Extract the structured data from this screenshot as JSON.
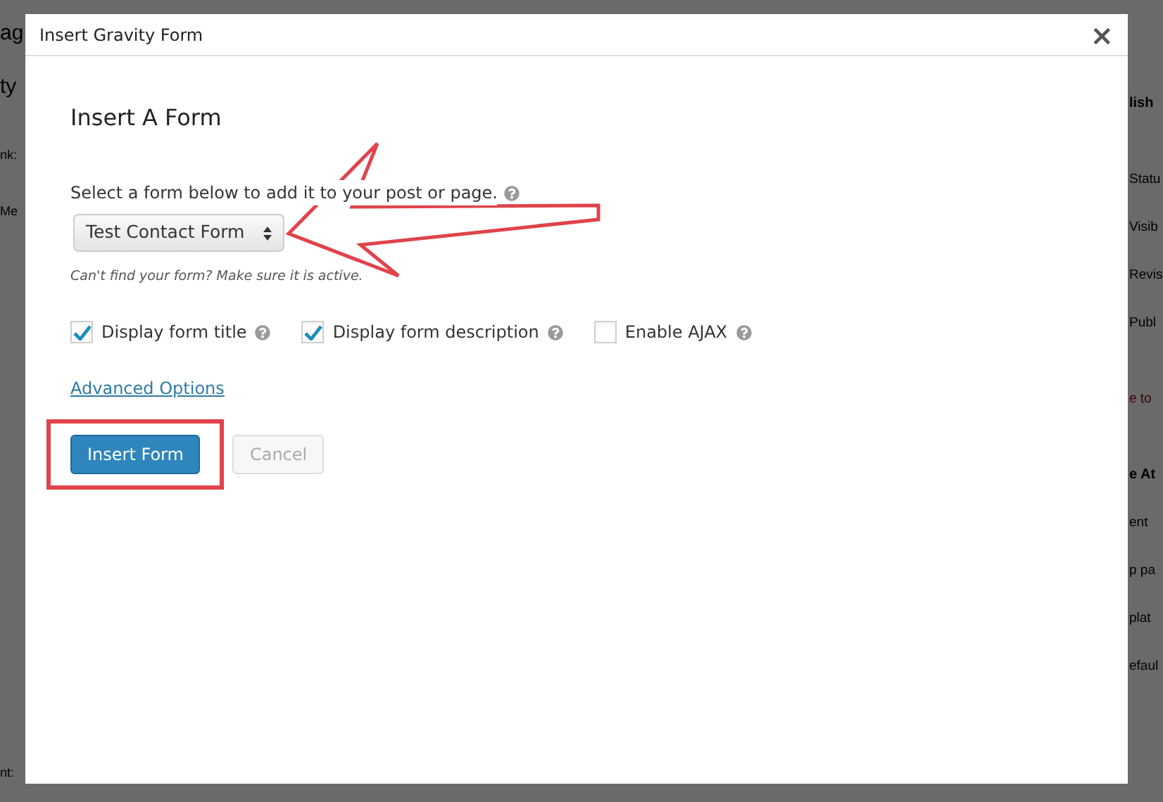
{
  "background": {
    "left_fragments": [
      "ag",
      "ty",
      "nk:",
      "Me",
      "nt:"
    ],
    "right_fragments": [
      {
        "text": "lish",
        "kind": "heading"
      },
      {
        "text": "Statu",
        "kind": "item"
      },
      {
        "text": "Visib",
        "kind": "item"
      },
      {
        "text": "Revis",
        "kind": "item"
      },
      {
        "text": "Publ",
        "kind": "item"
      },
      {
        "text": "e to",
        "kind": "alert"
      },
      {
        "text": "e At",
        "kind": "heading"
      },
      {
        "text": "ent",
        "kind": "item"
      },
      {
        "text": "p pa",
        "kind": "item"
      },
      {
        "text": "plat",
        "kind": "item"
      },
      {
        "text": "efaul",
        "kind": "item"
      }
    ]
  },
  "dialog": {
    "title": "Insert Gravity Form",
    "close": "×",
    "heading": "Insert A Form",
    "select_label": "Select a form below to add it to your post or page.",
    "select": {
      "value": "Test Contact Form"
    },
    "hint": "Can't find your form? Make sure it is active.",
    "options": [
      {
        "label": "Display form title",
        "checked": true
      },
      {
        "label": "Display form description",
        "checked": true
      },
      {
        "label": "Enable AJAX",
        "checked": false
      }
    ],
    "advanced_link": "Advanced Options",
    "buttons": [
      {
        "label": "Insert Form",
        "kind": "primary",
        "highlighted": true
      },
      {
        "label": "Cancel",
        "kind": "disabled",
        "highlighted": false
      }
    ]
  }
}
